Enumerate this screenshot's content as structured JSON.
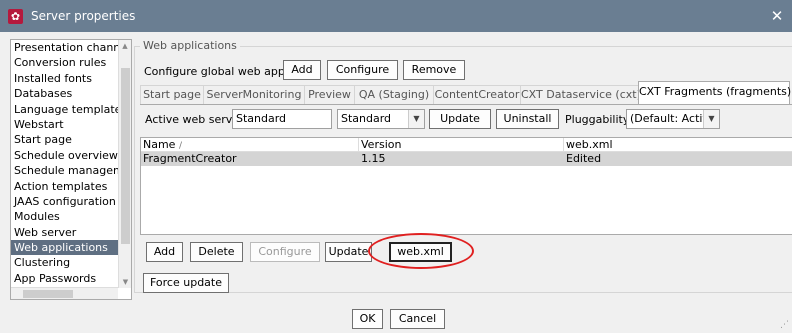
{
  "window": {
    "title": "Server properties",
    "close_glyph": "✕",
    "app_icon": "settings-icon"
  },
  "nav": {
    "items": [
      "Presentation channels",
      "Conversion rules",
      "Installed fonts",
      "Databases",
      "Language templates",
      "Webstart",
      "Start page",
      "Schedule overview",
      "Schedule management",
      "Action templates",
      "JAAS configuration",
      "Modules",
      "Web server",
      "Web applications",
      "Clustering",
      "App Passwords"
    ],
    "selected": "Web applications"
  },
  "group": {
    "title": "Web applications",
    "configure_label": "Configure global web apps:",
    "buttons": {
      "add": "Add",
      "configure": "Configure",
      "remove": "Remove"
    }
  },
  "tabs": [
    "Start page",
    "ServerMonitoring",
    "Preview",
    "QA (Staging)",
    "ContentCreator",
    "CXT Dataservice (cxt)",
    "CXT Fragments (fragments)"
  ],
  "active_tab": "CXT Fragments (fragments)",
  "webserver": {
    "label": "Active web server:",
    "value": "Standard",
    "combo_value": "Standard",
    "update": "Update",
    "uninstall": "Uninstall",
    "pluggability_label": "Pluggability:",
    "pluggability_value": "(Default: Active)"
  },
  "table": {
    "columns": [
      "Name",
      "Version",
      "web.xml"
    ],
    "sort_indicator": "/",
    "rows": [
      {
        "name": "FragmentCreator",
        "version": "1.15",
        "webxml": "Edited"
      }
    ]
  },
  "actions": {
    "add": "Add",
    "delete": "Delete",
    "configure": "Configure",
    "update": "Update",
    "webxml": "web.xml",
    "force_update": "Force update"
  },
  "dialog": {
    "ok": "OK",
    "cancel": "Cancel"
  },
  "colors": {
    "titlebar": "#6a7e92",
    "selection": "#5f6f82",
    "highlight_circle": "#e02020"
  }
}
